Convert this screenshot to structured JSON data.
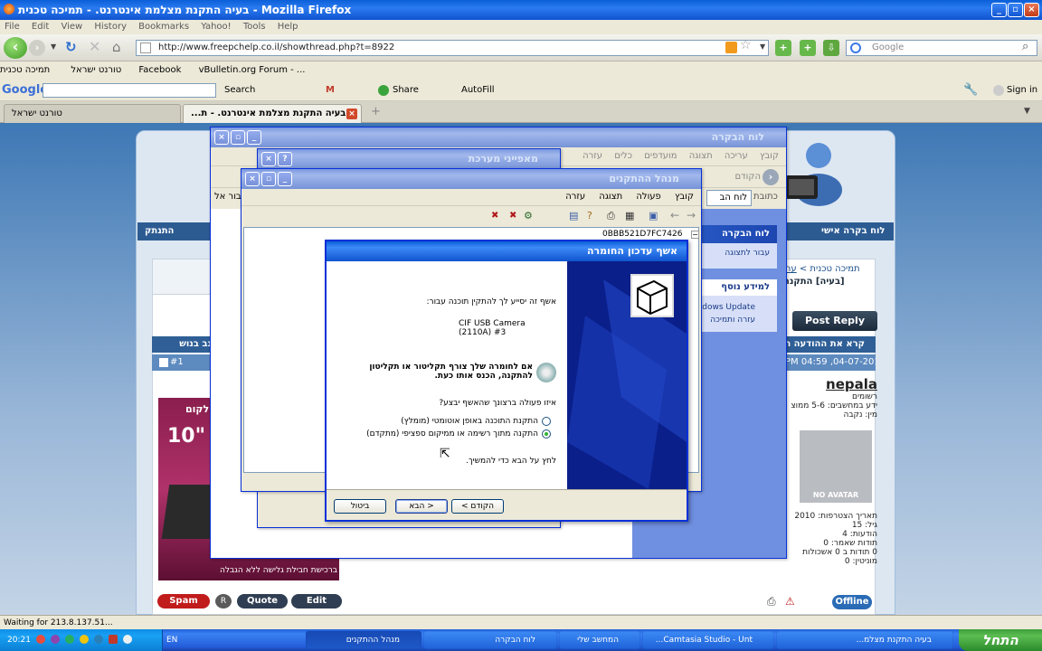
{
  "browser": {
    "title": "בעיה התקנת מצלמת אינטרנט. - תמיכה טכנית - Mozilla Firefox",
    "menu": [
      "File",
      "Edit",
      "View",
      "History",
      "Bookmarks",
      "Yahoo!",
      "Tools",
      "Help"
    ],
    "url": "http://www.freepchelp.co.il/showthread.php?t=8922",
    "search_placeholder": "Google",
    "bookmarks": [
      "טורנט ישראל",
      "תמיכה טכנית",
      "Facebook",
      "vBulletin.org Forum - ..."
    ],
    "google_toolbar": {
      "logo": "Google",
      "search": "Search",
      "share": "Share",
      "autofill": "AutoFill",
      "signin": "Sign in"
    },
    "tabs": [
      "טורנט ישראל",
      "...בעיה התקנת מצלמת אינטרנט. - ת"
    ],
    "status": "Waiting for 213.8.137.51..."
  },
  "forum": {
    "nav": {
      "right": "לוח בקרה אישי",
      "left": "התנתק"
    },
    "breadcrumb": "תמיכה טכנית",
    "thread_prefix": "[בעיה] התקנת",
    "post_reply": "Post Reply",
    "thread_bar": "קרא את ההודעה הרא",
    "post_date": "PM 04:59 ,04-07-2010",
    "post_number": "#1",
    "thread_tools": "נב בנושא",
    "username": "nepala",
    "user_title": "רשומים",
    "user_lines": [
      "ידע במחשבים: 5-6 ממוצ",
      "מין: נקבה"
    ],
    "avatar_text": "NO AVATAR",
    "join_date": "תאריך הצטרפות: 2010",
    "stats": [
      "גיל: 15",
      "הודעות: 4",
      "תודות שאמר: 0",
      "0 תודות ב 0 אשכולות",
      "מוניטין: 0"
    ],
    "ad": {
      "brand": "טלקום",
      "headline": "10\" L",
      "caption": "ברכישת חבילת גלישה ללא הגבלה"
    },
    "buttons": {
      "spam": "Spam",
      "quote": "Quote",
      "edit": "Edit",
      "offline": "Offline"
    }
  },
  "control_panel": {
    "title": "לוח הבקרה",
    "menu": [
      "קובץ",
      "עריכה",
      "תצוגה",
      "מועדפים",
      "כלים",
      "עזרה"
    ],
    "back": "הקודם",
    "address_label": "כתובת",
    "address_value": "לוח הב",
    "side_title": "לוח הבקרה",
    "side_link": "עבור לתצוגה",
    "more_info": "למידע נוסף",
    "windows_update": "Windows Update",
    "help": "עזרה ותמיכה",
    "fragment": "בור אל"
  },
  "sys_props": {
    "title": "מאפייני מערכת"
  },
  "device_manager": {
    "title": "מנהל ההתקנים",
    "menu": [
      "קובץ",
      "פעולה",
      "תצוגה",
      "עזרה"
    ],
    "tree_item": "0BBB521D7FC7426"
  },
  "wizard": {
    "title": "אשף עדכון החומרה",
    "intro": "אשף זה יסייע לך להתקין תוכנה עבור:",
    "device": "CIF USB Camera (2110A) #3",
    "cd_note": "אם לחומרה שלך צורף תקליטור או תקליטון להתקנה, הכנס אותו כעת.",
    "question": "איזו פעולה ברצונך שהאשף יבצע?",
    "options": [
      "התקנת התוכנה באופן אוטומטי (מומלץ)",
      "התקנה מתוך רשימה או ממיקום ספציפי (מתקדם)"
    ],
    "selected_option": 2,
    "continue": "לחץ על הבא כדי להמשיך.",
    "buttons": {
      "back": "< הקודם",
      "next": "הבא >",
      "cancel": "ביטול"
    }
  },
  "taskbar": {
    "start": "התחל",
    "items": [
      "בעיה התקנת מצלמ...",
      "Camtasia Studio - Unt...",
      "המחשב שלי",
      "לוח הבקרה",
      "מנהל ההתקנים"
    ],
    "lang": "EN",
    "clock": "20:21"
  }
}
